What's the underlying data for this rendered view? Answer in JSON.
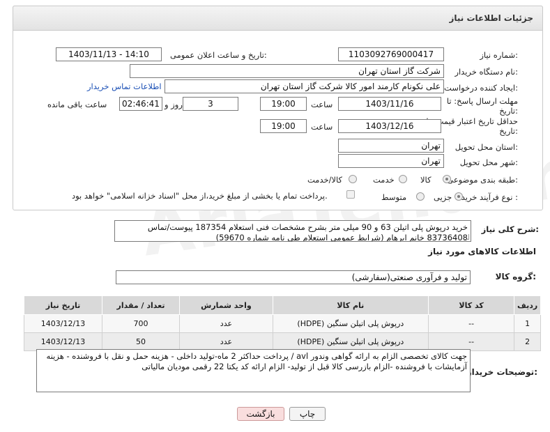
{
  "header": {
    "title": "جزئیات اطلاعات نیاز"
  },
  "form": {
    "need_number_label": "شماره نیاز:",
    "need_number": "1103092769000417",
    "announce_label": "تاریخ و ساعت اعلان عمومی:",
    "announce_value": "1403/11/13 - 14:10",
    "buyer_org_label": "نام دستگاه خریدار:",
    "buyer_org": "شرکت گاز استان تهران",
    "requester_label": "ایجاد کننده درخواست:",
    "requester": "علی نکونام کارمند امور کالا شرکت گاز استان تهران",
    "contact_link": "اطلاعات تماس خریدار",
    "send_deadline_label_1": "مهلت ارسال پاسخ: تا",
    "send_deadline_label_2": "تاریخ:",
    "send_date": "1403/11/16",
    "time_label": "ساعت",
    "send_time": "19:00",
    "days_count": "3",
    "day_label": "روز و",
    "remaining_time": "02:46:41",
    "remaining_label": "ساعت باقی مانده",
    "price_validity_label_1": "حداقل تاریخ اعتبار قیمت: تا",
    "price_validity_label_2": "تاریخ:",
    "price_date": "1403/12/16",
    "price_time": "19:00",
    "province_label": "استان محل تحویل:",
    "province": "تهران",
    "city_label": "شهر محل تحویل:",
    "city": "تهران",
    "category_label": "طبقه بندی موضوعی:",
    "category_options": [
      "کالا",
      "خدمت",
      "کالا/خدمت"
    ],
    "process_label": "نوع فرآیند خرید :",
    "process_options": [
      "جزیی",
      "متوسط"
    ],
    "payment_note": "پرداخت تمام یا بخشی از مبلغ خرید،از محل \"اسناد خزانه اسلامی\" خواهد بود."
  },
  "summary": {
    "label": "شرح کلی نیاز:",
    "text": "خرید درپوش پلی اتیلن 63 و 90 میلی متر بشرح مشخصات فنی استعلام 187354 پیوست/تماس 83736408 خانم ابرهام (شرایط عمومی استعلام طی نامه شماره 59670)"
  },
  "goods": {
    "section_title": "اطلاعات کالاهای مورد نیاز",
    "group_label": "گروه کالا:",
    "group_value": "تولید و فرآوری صنعتی(سفارشی)",
    "columns": [
      "ردیف",
      "کد کالا",
      "نام کالا",
      "واحد شمارش",
      "تعداد / مقدار",
      "تاریخ نیاز"
    ],
    "rows": [
      [
        "1",
        "--",
        "درپوش پلی اتیلن سنگین (HDPE)",
        "عدد",
        "700",
        "1403/12/13"
      ],
      [
        "2",
        "--",
        "درپوش پلی اتیلن سنگین (HDPE)",
        "عدد",
        "50",
        "1403/12/13"
      ]
    ]
  },
  "notes": {
    "label": "توضیحات خریدار:",
    "text": "جهت کالای تخصصی الزام به ارائه گواهی وندور avl / پرداخت حداکثر 2 ماه-تولید داخلی - هزینه حمل و نقل با فروشنده - هزینه آزمایشات با فروشنده -الزام بازرسی کالا قبل از تولید- الزام ارائه کد یکتا 22 رقمی مودیان مالیاتی"
  },
  "buttons": {
    "print": "چاپ",
    "back": "بازگشت"
  },
  "watermark": "AriaTender.neT"
}
